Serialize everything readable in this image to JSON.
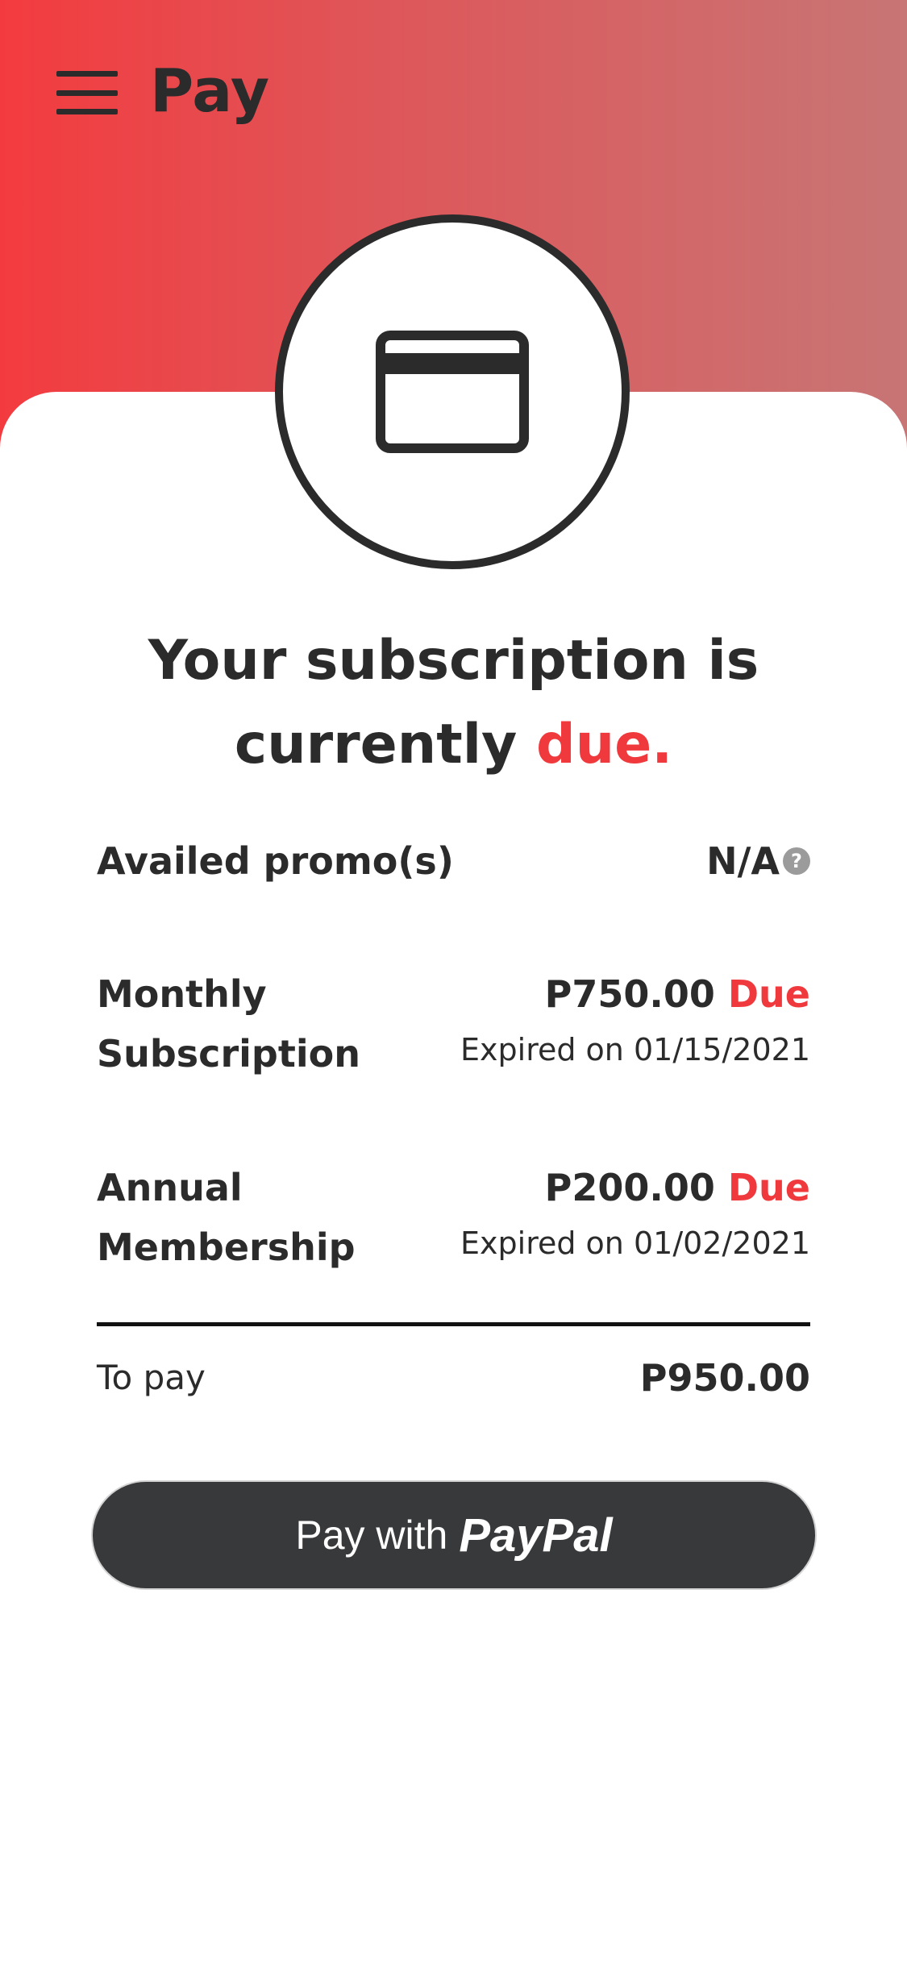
{
  "header": {
    "title": "Pay",
    "menu_icon": "hamburger-menu-icon",
    "gradient": [
      "#f33b3f",
      "#c87575"
    ]
  },
  "badge": {
    "icon": "credit-card-icon"
  },
  "headline": {
    "line1": "Your subscription is",
    "line2_prefix": "currently",
    "line2_accent": "due."
  },
  "promo": {
    "label": "Availed promo(s)",
    "value": "N/A",
    "help_glyph": "?"
  },
  "items": [
    {
      "label_line1": "Monthly",
      "label_line2": "Subscription",
      "amount": "P750.00",
      "status": "Due",
      "expiry": "Expired on 01/15/2021"
    },
    {
      "label_line1": "Annual",
      "label_line2": "Membership",
      "amount": "P200.00",
      "status": "Due",
      "expiry": "Expired on 01/02/2021"
    }
  ],
  "total": {
    "label": "To pay",
    "amount": "P950.00"
  },
  "pay_button": {
    "prefix": "Pay with",
    "brand": "PayPal"
  },
  "colors": {
    "accent": "#f0393d",
    "text": "#2b2b2b",
    "button": "#38393b"
  }
}
